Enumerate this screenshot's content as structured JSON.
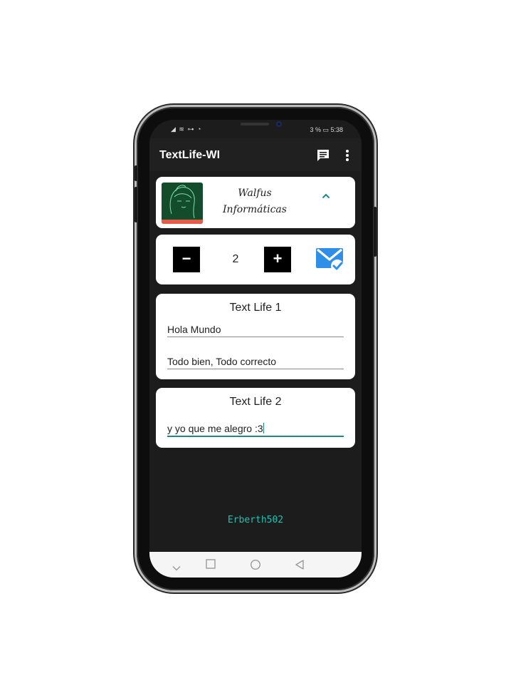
{
  "status_bar": {
    "left_icons": "◢ ≋ ⊶ ◔",
    "battery_text": "3 % ▭ 5:38"
  },
  "app_bar": {
    "title": "TextLife-WI",
    "icons": [
      "chat-icon",
      "more-vert-icon"
    ]
  },
  "profile_card": {
    "brand_line1": "Walfus",
    "brand_line2": "Informáticas",
    "expand_icon": "chevron-up-icon"
  },
  "counter_card": {
    "decrement_label": "−",
    "value": "2",
    "increment_label": "+",
    "send_icon": "mail-check-icon",
    "send_icon_color": "#2f8fe8"
  },
  "text_life_1": {
    "title": "Text Life 1",
    "field1_value": "Hola Mundo",
    "field2_value": "Todo bien, Todo correcto"
  },
  "text_life_2": {
    "title": "Text Life 2",
    "field1_value": "y yo que me alegro :3"
  },
  "credit": "Erberth502",
  "colors": {
    "accent": "#1a8a80",
    "credit": "#22c1b0",
    "background": "#1c1c1c"
  },
  "nav_bar": {
    "icons": [
      "chevron-down-icon",
      "recents-icon",
      "home-icon",
      "back-icon"
    ]
  }
}
